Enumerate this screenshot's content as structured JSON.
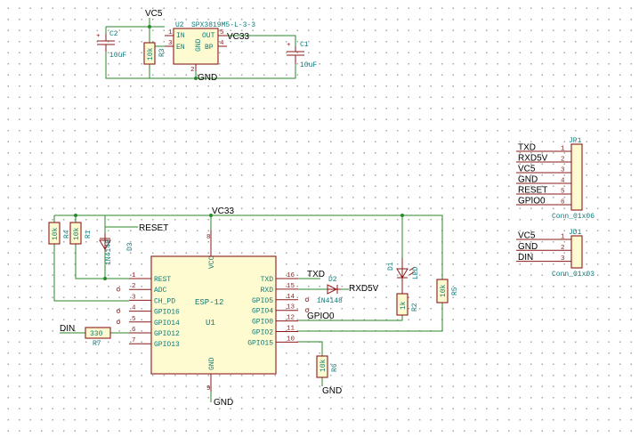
{
  "nets": {
    "vc5_top": "VC5",
    "vc33_reg": "VC33",
    "gnd_reg": "GND",
    "vc33_main": "VC33",
    "reset": "RESET",
    "txd": "TXD",
    "rxd5v": "RXD5V",
    "gpio0": "GPIO0",
    "din": "DIN",
    "gnd_r6": "GND",
    "gnd_u1": "GND"
  },
  "regulator": {
    "ref": "U2",
    "value": "SPX3819M5-L-3-3",
    "pins": [
      {
        "num": "1",
        "name": "IN"
      },
      {
        "num": "3",
        "name": "EN"
      },
      {
        "num": "5",
        "name": "OUT"
      },
      {
        "num": "4",
        "name": "BP"
      },
      {
        "num": "2",
        "name": "GND"
      }
    ]
  },
  "capacitors": [
    {
      "ref": "C2",
      "value": "10uF",
      "polarity": "+"
    },
    {
      "ref": "C1",
      "value": "10uF",
      "polarity": "+"
    }
  ],
  "resistors": [
    {
      "ref": "R3",
      "value": "10k"
    },
    {
      "ref": "R4",
      "value": "10k"
    },
    {
      "ref": "R1",
      "value": "10k"
    },
    {
      "ref": "R7",
      "value": "330"
    },
    {
      "ref": "R2",
      "value": "1k"
    },
    {
      "ref": "R5",
      "value": "10k"
    },
    {
      "ref": "R6",
      "value": "10k"
    }
  ],
  "diodes": [
    {
      "ref": "D3",
      "value": "1N4148"
    },
    {
      "ref": "D2",
      "value": "1N4148"
    },
    {
      "ref": "D1",
      "value": "LED"
    }
  ],
  "mcu": {
    "ref": "U1",
    "value": "ESP-12",
    "top_pin": {
      "num": "8",
      "name": "VCC"
    },
    "bottom_pin": {
      "num": "9",
      "name": "GND"
    },
    "left_pins": [
      {
        "num": "1",
        "name": "REST"
      },
      {
        "num": "2",
        "name": "ADC"
      },
      {
        "num": "3",
        "name": "CH_PD"
      },
      {
        "num": "4",
        "name": "GPIO16"
      },
      {
        "num": "5",
        "name": "GPIO14"
      },
      {
        "num": "6",
        "name": "GPIO12"
      },
      {
        "num": "7",
        "name": "GPIO13"
      }
    ],
    "right_pins": [
      {
        "num": "16",
        "name": "TXD"
      },
      {
        "num": "15",
        "name": "RXD"
      },
      {
        "num": "14",
        "name": "GPIO5"
      },
      {
        "num": "13",
        "name": "GPIO4"
      },
      {
        "num": "12",
        "name": "GPIO0"
      },
      {
        "num": "11",
        "name": "GPIO2"
      },
      {
        "num": "10",
        "name": "GPIO15"
      }
    ]
  },
  "connectors": [
    {
      "ref": "JP1",
      "value": "Conn_01x06",
      "pins": [
        {
          "num": "1",
          "net": "TXD"
        },
        {
          "num": "2",
          "net": "RXD5V"
        },
        {
          "num": "3",
          "net": "VC5"
        },
        {
          "num": "4",
          "net": "GND"
        },
        {
          "num": "5",
          "net": "RESET"
        },
        {
          "num": "6",
          "net": "GPIO0"
        }
      ]
    },
    {
      "ref": "JD1",
      "value": "Conn_01x03",
      "pins": [
        {
          "num": "1",
          "net": "VC5"
        },
        {
          "num": "2",
          "net": "GND"
        },
        {
          "num": "3",
          "net": "DIN"
        }
      ]
    }
  ]
}
